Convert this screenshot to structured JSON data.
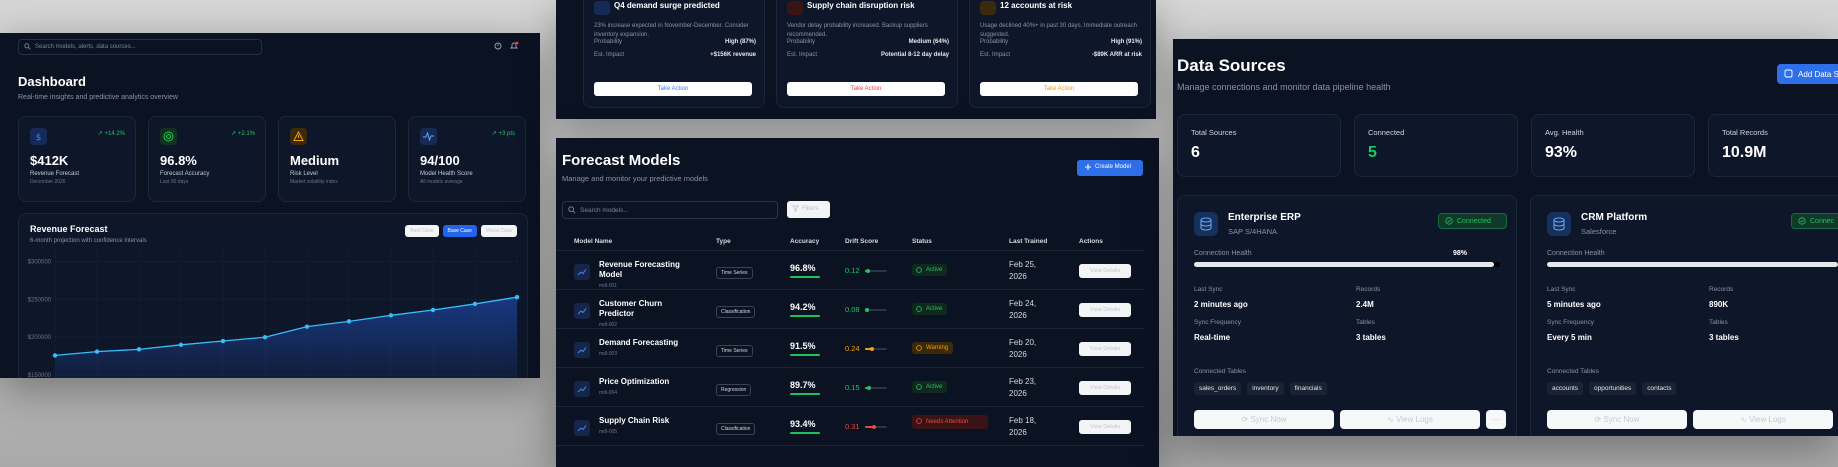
{
  "dashboard": {
    "search_placeholder": "Search models, alerts, data sources...",
    "title": "Dashboard",
    "subtitle": "Real-time insights and predictive analytics overview",
    "kpis": [
      {
        "icon": "dollar-icon",
        "change": "+14.2%",
        "value": "$412K",
        "label": "Revenue Forecast",
        "note": "December 2026",
        "color": "#3b82f6"
      },
      {
        "icon": "target-icon",
        "change": "+2.1%",
        "value": "96.8%",
        "label": "Forecast Accuracy",
        "note": "Last 90 days",
        "color": "#22c55e"
      },
      {
        "icon": "warning-icon",
        "change": "",
        "value": "Medium",
        "label": "Risk Level",
        "note": "Market volatility index",
        "color": "#f59e0b"
      },
      {
        "icon": "activity-icon",
        "change": "+3 pts",
        "value": "94/100",
        "label": "Model Health Score",
        "note": "All models average",
        "color": "#60a5fa"
      }
    ],
    "revenue_chart": {
      "title": "Revenue Forecast",
      "subtitle": "6-month projection with confidence intervals",
      "buttons": [
        "Best Case",
        "Base Case",
        "Worst Case"
      ],
      "active_button": "Base Case"
    }
  },
  "alerts": [
    {
      "icon": "trend-up-icon",
      "title": "Q4 demand surge predicted",
      "desc": "23% increase expected in November-December. Consider inventory expansion.",
      "prob_label": "Probability",
      "prob": "High (87%)",
      "impact_label": "Est. Impact",
      "impact": "+$156K revenue",
      "action": "Take Action",
      "color": "#3b82f6"
    },
    {
      "icon": "alert-icon",
      "title": "Supply chain disruption risk",
      "desc": "Vendor delay probability increased. Backup suppliers recommended.",
      "prob_label": "Probability",
      "prob": "Medium (64%)",
      "impact_label": "Est. Impact",
      "impact": "Potential 8-12 day delay",
      "action": "Take Action",
      "color": "#ef4444"
    },
    {
      "icon": "users-icon",
      "title": "12 accounts at risk",
      "desc": "Usage declined 40%+ in past 30 days. Immediate outreach suggested.",
      "prob_label": "Probability",
      "prob": "High (91%)",
      "impact_label": "Est. Impact",
      "impact": "-$89K ARR at risk",
      "action": "Take Action",
      "color": "#f59e0b"
    }
  ],
  "models": {
    "title": "Forecast Models",
    "subtitle": "Manage and monitor your predictive models",
    "create_label": "Create Model",
    "search_placeholder": "Search models...",
    "filters_label": "Filters",
    "columns": [
      "Model Name",
      "Type",
      "Accuracy",
      "Drift Score",
      "Status",
      "Last Trained",
      "Actions"
    ],
    "rows": [
      {
        "name": "Revenue Forecasting Model",
        "id": "mdl-001",
        "type": "Time Series",
        "accuracy": "96.8%",
        "drift": "0.12",
        "drift_level": 0.15,
        "status": "Active",
        "status_kind": "active",
        "trained": "Feb 25, 2026",
        "action": "View Details"
      },
      {
        "name": "Customer Churn Predictor",
        "id": "mdl-002",
        "type": "Classification",
        "accuracy": "94.2%",
        "drift": "0.08",
        "drift_level": 0.1,
        "status": "Active",
        "status_kind": "active",
        "trained": "Feb 24, 2026",
        "action": "View Details"
      },
      {
        "name": "Demand Forecasting",
        "id": "mdl-003",
        "type": "Time Series",
        "accuracy": "91.5%",
        "drift": "0.24",
        "drift_level": 0.3,
        "status": "Warning",
        "status_kind": "warn",
        "trained": "Feb 20, 2026",
        "action": "View Details"
      },
      {
        "name": "Price Optimization",
        "id": "mdl-004",
        "type": "Regression",
        "accuracy": "89.7%",
        "drift": "0.15",
        "drift_level": 0.18,
        "status": "Active",
        "status_kind": "active",
        "trained": "Feb 23, 2026",
        "action": "View Details"
      },
      {
        "name": "Supply Chain Risk",
        "id": "mdl-005",
        "type": "Classification",
        "accuracy": "93.4%",
        "drift": "0.31",
        "drift_level": 0.4,
        "status": "Needs Attention",
        "status_kind": "need",
        "trained": "Feb 18, 2026",
        "action": "View Details"
      }
    ]
  },
  "data_sources": {
    "title": "Data Sources",
    "subtitle": "Manage connections and monitor data pipeline health",
    "add_label": "Add Data S",
    "stats": [
      {
        "label": "Total Sources",
        "value": "6",
        "color": "#ffffff"
      },
      {
        "label": "Connected",
        "value": "5",
        "color": "#22c55e"
      },
      {
        "label": "Avg. Health",
        "value": "93%",
        "color": "#ffffff"
      },
      {
        "label": "Total Records",
        "value": "10.9M",
        "color": "#ffffff"
      }
    ],
    "sources": [
      {
        "name": "Enterprise ERP",
        "vendor": "SAP S/4HANA",
        "status": "Connected",
        "health_label": "Connection Health",
        "health": "98%",
        "health_value": 0.98,
        "last_sync_label": "Last Sync",
        "last_sync": "2 minutes ago",
        "records_label": "Records",
        "records": "2.4M",
        "freq_label": "Sync Frequency",
        "freq": "Real-time",
        "tables_label": "Tables",
        "tables": "3 tables",
        "connected_label": "Connected Tables",
        "tags": [
          "sales_orders",
          "inventory",
          "financials"
        ],
        "sync_label": "Sync Now",
        "logs_label": "View Logs"
      },
      {
        "name": "CRM Platform",
        "vendor": "Salesforce",
        "status": "Connec",
        "health_label": "Connection Health",
        "health": "",
        "health_value": 0.95,
        "last_sync_label": "Last Sync",
        "last_sync": "5 minutes ago",
        "records_label": "Records",
        "records": "890K",
        "freq_label": "Sync Frequency",
        "freq": "Every 5 min",
        "tables_label": "Tables",
        "tables": "3 tables",
        "connected_label": "Connected Tables",
        "tags": [
          "accounts",
          "opportunities",
          "contacts"
        ],
        "sync_label": "Sync Now",
        "logs_label": "View Logs"
      }
    ]
  },
  "chart_data": {
    "type": "line",
    "title": "Revenue Forecast",
    "subtitle": "6-month projection with confidence intervals",
    "y_tick_labels": [
      "$300000",
      "$250000",
      "$200000",
      "$150000"
    ],
    "y_ticks": [
      300000,
      250000,
      200000,
      150000
    ],
    "ylim": [
      125000,
      310000
    ],
    "grid": true,
    "series": [
      {
        "values": [
          176000,
          181000,
          184000,
          190000,
          195000,
          200000,
          214000,
          221000,
          229000,
          236000,
          244000,
          253000
        ]
      }
    ]
  }
}
